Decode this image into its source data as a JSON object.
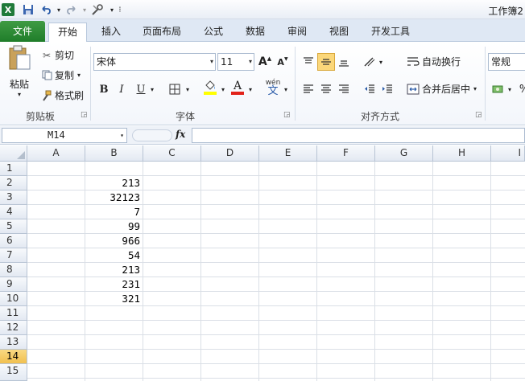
{
  "window": {
    "title": "工作簿2"
  },
  "quick_access": {
    "app_icon": "excel-icon",
    "save": "save-icon",
    "undo": "undo-icon",
    "redo": "redo-icon",
    "custom": "tools-icon"
  },
  "tabs": [
    "文件",
    "开始",
    "插入",
    "页面布局",
    "公式",
    "数据",
    "审阅",
    "视图",
    "开发工具"
  ],
  "active_tab": "开始",
  "clipboard": {
    "paste_label": "粘贴",
    "cut_label": "剪切",
    "copy_label": "复制",
    "format_painter_label": "格式刷",
    "group_label": "剪贴板"
  },
  "font": {
    "font_name": "宋体",
    "font_size": "11",
    "bold": "B",
    "italic": "I",
    "underline": "U",
    "phonetic": "wén",
    "group_label": "字体",
    "font_color": "#e2231a",
    "fill_color": "#ffff00"
  },
  "alignment": {
    "wrap_label": "自动换行",
    "merge_label": "合并后居中",
    "group_label": "对齐方式"
  },
  "number": {
    "format_value": "常规"
  },
  "formula_bar": {
    "name_box": "M14",
    "fx": "fx",
    "formula": ""
  },
  "sheet": {
    "columns": [
      "A",
      "B",
      "C",
      "D",
      "E",
      "F",
      "G",
      "H",
      "I"
    ],
    "rows": [
      "1",
      "2",
      "3",
      "4",
      "5",
      "6",
      "7",
      "8",
      "9",
      "10",
      "11",
      "12",
      "13",
      "14",
      "15"
    ],
    "active_row": "14",
    "column_b_values": [
      "",
      "213",
      "32123",
      "7",
      "99",
      "966",
      "54",
      "213",
      "231",
      "321",
      "",
      "",
      "",
      "",
      ""
    ]
  }
}
